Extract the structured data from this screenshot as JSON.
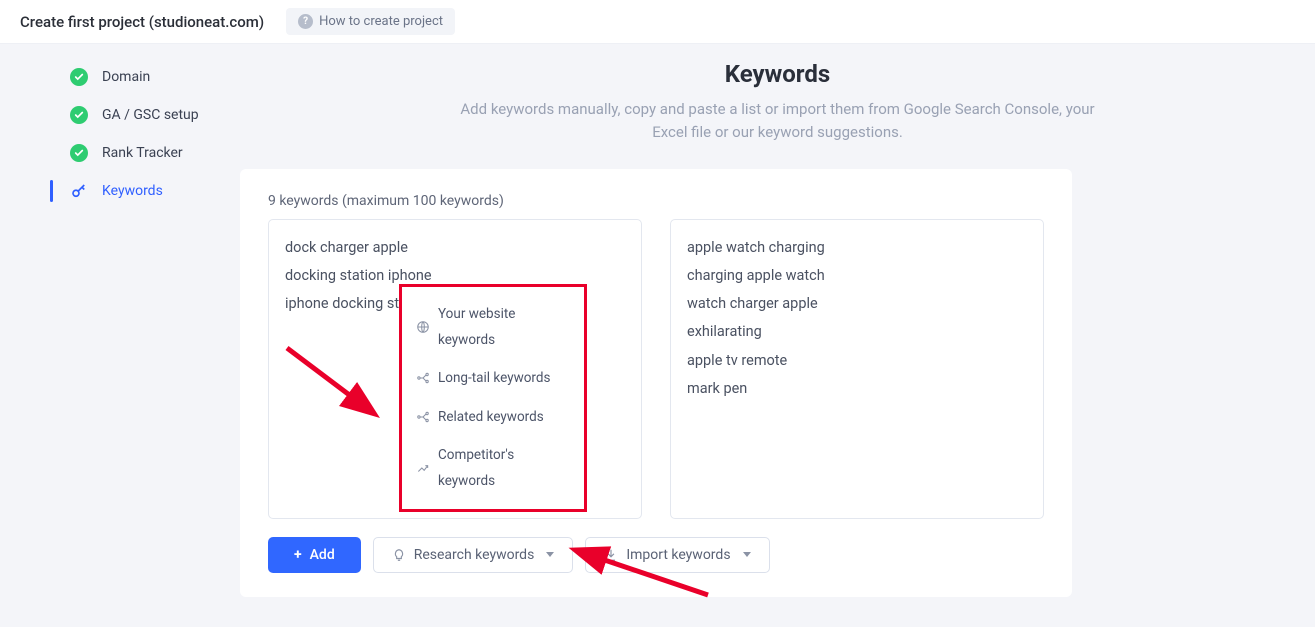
{
  "topbar": {
    "title": "Create first project (studioneat.com)",
    "howto": "How to create project"
  },
  "sidebar": {
    "steps": [
      {
        "label": "Domain",
        "done": true,
        "active": false
      },
      {
        "label": "GA / GSC setup",
        "done": true,
        "active": false
      },
      {
        "label": "Rank Tracker",
        "done": true,
        "active": false
      },
      {
        "label": "Keywords",
        "done": false,
        "active": true
      }
    ]
  },
  "page": {
    "heading": "Keywords",
    "subtitle": "Add keywords manually, copy and paste a list or import them from Google Search Console, your Excel file or our keyword suggestions.",
    "counter": "9 keywords (maximum 100 keywords)"
  },
  "keywords": {
    "left": [
      "dock charger apple",
      "docking station iphone",
      "iphone docking station"
    ],
    "right": [
      "apple watch charging",
      "charging apple watch",
      "watch charger apple",
      "exhilarating",
      "apple tv remote",
      "mark pen"
    ]
  },
  "dropdown": {
    "items": [
      "Your website keywords",
      "Long-tail keywords",
      "Related keywords",
      "Competitor's keywords"
    ]
  },
  "buttons": {
    "add": "Add",
    "research": "Research keywords",
    "import": "Import keywords"
  }
}
